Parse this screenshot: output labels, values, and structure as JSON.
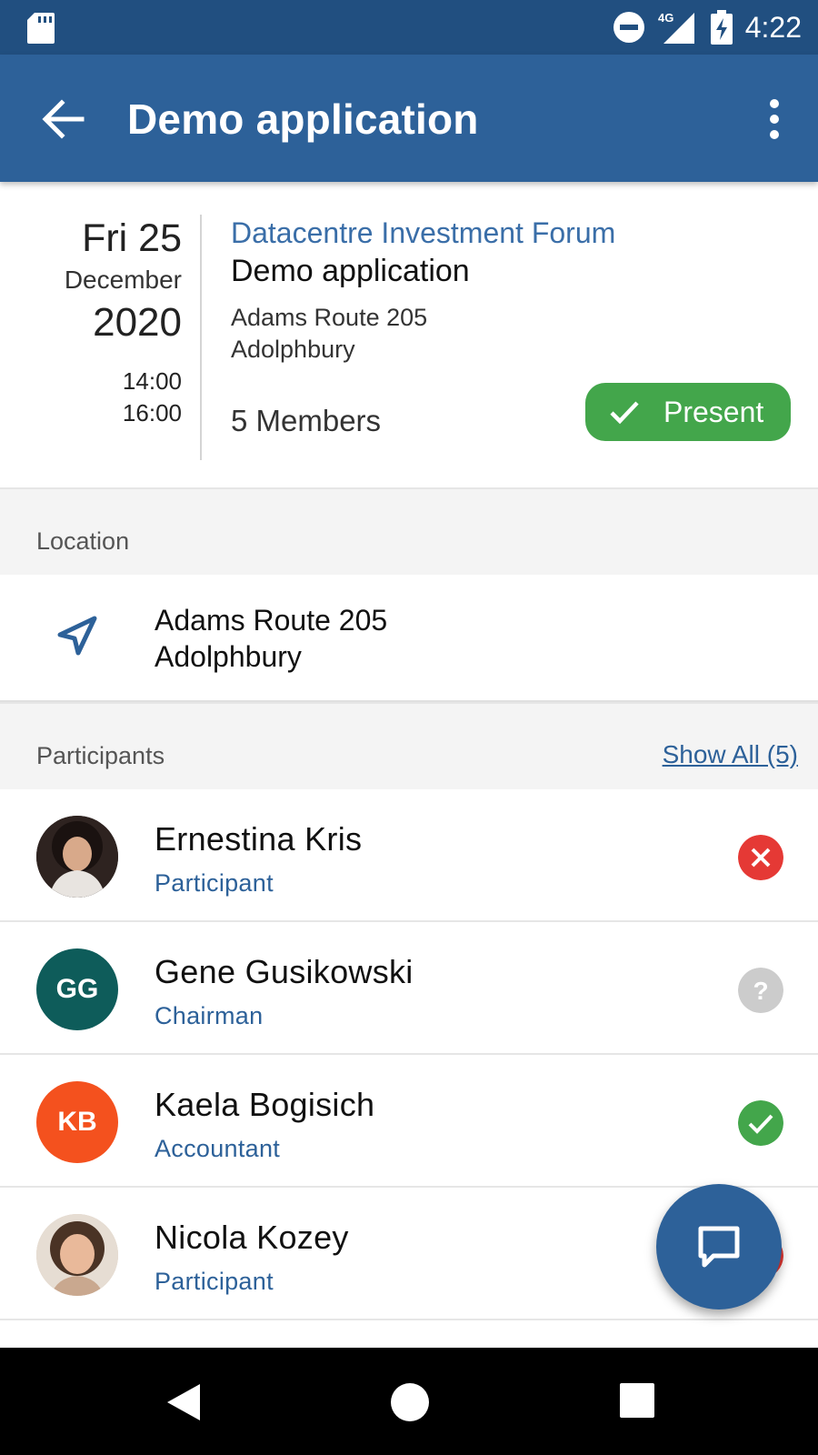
{
  "status_bar": {
    "time": "4:22",
    "network": "4G",
    "icons": [
      "sd-card-icon",
      "do-not-disturb-icon",
      "signal-icon",
      "battery-charging-icon"
    ]
  },
  "app_bar": {
    "title": "Demo application",
    "back_icon": "arrow-back-icon",
    "menu_icon": "more-vert-icon"
  },
  "event": {
    "day": "Fri 25",
    "month": "December",
    "year": "2020",
    "start_time": "14:00",
    "end_time": "16:00",
    "organization": "Datacentre Investment Forum",
    "name": "Demo application",
    "address_line1": "Adams Route 205",
    "address_line2": "Adolphbury",
    "members": "5 Members",
    "attendance_button": "Present",
    "attendance_color": "#43a64b"
  },
  "location": {
    "header": "Location",
    "address_line1": "Adams Route 205",
    "address_line2": "Adolphbury",
    "icon": "navigation-icon"
  },
  "participants": {
    "header": "Participants",
    "show_all": "Show All (5)",
    "items": [
      {
        "name": "Ernestina Kris",
        "role": "Participant",
        "initials": "",
        "avatar": "photo",
        "status": "declined",
        "status_color": "#e53935"
      },
      {
        "name": "Gene Gusikowski",
        "role": "Chairman",
        "initials": "GG",
        "avatar_color": "#0e5c5a",
        "status": "unknown",
        "status_color": "#cccccc"
      },
      {
        "name": "Kaela Bogisich",
        "role": "Accountant",
        "initials": "KB",
        "avatar_color": "#f4511e",
        "status": "accepted",
        "status_color": "#43a64b"
      },
      {
        "name": "Nicola Kozey",
        "role": "Participant",
        "initials": "",
        "avatar": "photo",
        "status": "declined",
        "status_color": "#e53935"
      }
    ]
  },
  "fab": {
    "icon": "chat-icon"
  },
  "nav_bar": {
    "icons": [
      "nav-back-icon",
      "nav-home-icon",
      "nav-recents-icon"
    ]
  },
  "colors": {
    "primary": "#2d6199",
    "primary_dark": "#214f80",
    "accent_link": "#3a6ea8"
  }
}
